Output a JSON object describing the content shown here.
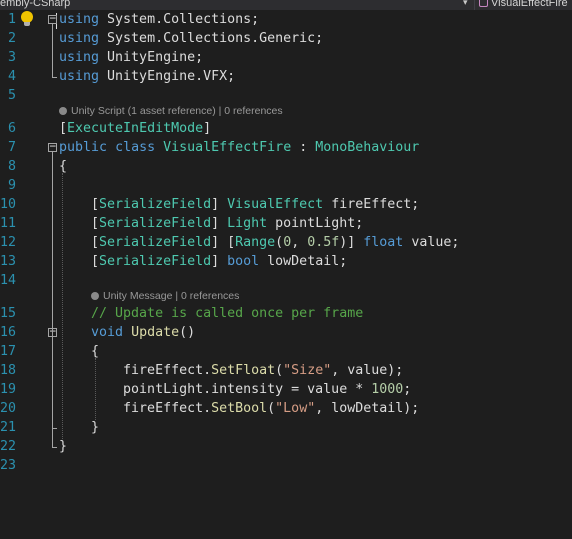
{
  "navbar": {
    "project": "embly-CSharp",
    "dropdown_glyph": "▾",
    "member": "VisualEffectFire",
    "member_icon": "class-icon"
  },
  "editor": {
    "lines": [
      {
        "n": "1",
        "tokens": [
          {
            "t": "using",
            "c": "kw"
          },
          {
            "t": " System.Collections;",
            "c": ""
          }
        ]
      },
      {
        "n": "2",
        "tokens": [
          {
            "t": "using",
            "c": "kw"
          },
          {
            "t": " System.Collections.Generic;",
            "c": ""
          }
        ]
      },
      {
        "n": "3",
        "tokens": [
          {
            "t": "using",
            "c": "kw"
          },
          {
            "t": " UnityEngine;",
            "c": ""
          }
        ]
      },
      {
        "n": "4",
        "tokens": [
          {
            "t": "using",
            "c": "kw"
          },
          {
            "t": " UnityEngine.VFX;",
            "c": ""
          }
        ]
      },
      {
        "n": "5",
        "tokens": []
      },
      {
        "n": "6",
        "tokens": [
          {
            "t": "[",
            "c": ""
          },
          {
            "t": "ExecuteInEditMode",
            "c": "type"
          },
          {
            "t": "]",
            "c": ""
          }
        ]
      },
      {
        "n": "7",
        "tokens": [
          {
            "t": "public",
            "c": "kw"
          },
          {
            "t": " ",
            "c": ""
          },
          {
            "t": "class",
            "c": "kw"
          },
          {
            "t": " ",
            "c": ""
          },
          {
            "t": "VisualEffectFire",
            "c": "type"
          },
          {
            "t": " : ",
            "c": ""
          },
          {
            "t": "MonoBehaviour",
            "c": "type"
          }
        ]
      },
      {
        "n": "8",
        "tokens": [
          {
            "t": "{",
            "c": ""
          }
        ]
      },
      {
        "n": "9",
        "tokens": []
      },
      {
        "n": "10",
        "tokens": [
          {
            "t": "    [",
            "c": ""
          },
          {
            "t": "SerializeField",
            "c": "type"
          },
          {
            "t": "] ",
            "c": ""
          },
          {
            "t": "VisualEffect",
            "c": "type"
          },
          {
            "t": " fireEffect;",
            "c": ""
          }
        ]
      },
      {
        "n": "11",
        "tokens": [
          {
            "t": "    [",
            "c": ""
          },
          {
            "t": "SerializeField",
            "c": "type"
          },
          {
            "t": "] ",
            "c": ""
          },
          {
            "t": "Light",
            "c": "type"
          },
          {
            "t": " pointLight;",
            "c": ""
          }
        ]
      },
      {
        "n": "12",
        "tokens": [
          {
            "t": "    [",
            "c": ""
          },
          {
            "t": "SerializeField",
            "c": "type"
          },
          {
            "t": "] [",
            "c": ""
          },
          {
            "t": "Range",
            "c": "type"
          },
          {
            "t": "(",
            "c": ""
          },
          {
            "t": "0",
            "c": "num"
          },
          {
            "t": ", ",
            "c": ""
          },
          {
            "t": "0.5f",
            "c": "num"
          },
          {
            "t": ")] ",
            "c": ""
          },
          {
            "t": "float",
            "c": "kw"
          },
          {
            "t": " value;",
            "c": ""
          }
        ]
      },
      {
        "n": "13",
        "tokens": [
          {
            "t": "    [",
            "c": ""
          },
          {
            "t": "SerializeField",
            "c": "type"
          },
          {
            "t": "] ",
            "c": ""
          },
          {
            "t": "bool",
            "c": "kw"
          },
          {
            "t": " lowDetail;",
            "c": ""
          }
        ]
      },
      {
        "n": "14",
        "tokens": []
      },
      {
        "n": "15",
        "tokens": [
          {
            "t": "    // Update is called once per frame",
            "c": "comment"
          }
        ]
      },
      {
        "n": "16",
        "tokens": [
          {
            "t": "    ",
            "c": ""
          },
          {
            "t": "void",
            "c": "kw"
          },
          {
            "t": " ",
            "c": ""
          },
          {
            "t": "Update",
            "c": "method"
          },
          {
            "t": "()",
            "c": ""
          }
        ]
      },
      {
        "n": "17",
        "tokens": [
          {
            "t": "    {",
            "c": ""
          }
        ]
      },
      {
        "n": "18",
        "tokens": [
          {
            "t": "        fireEffect.",
            "c": ""
          },
          {
            "t": "SetFloat",
            "c": "method"
          },
          {
            "t": "(",
            "c": ""
          },
          {
            "t": "\"Size\"",
            "c": "str"
          },
          {
            "t": ", value);",
            "c": ""
          }
        ]
      },
      {
        "n": "19",
        "tokens": [
          {
            "t": "        pointLight.intensity = value * ",
            "c": ""
          },
          {
            "t": "1000",
            "c": "num"
          },
          {
            "t": ";",
            "c": ""
          }
        ]
      },
      {
        "n": "20",
        "tokens": [
          {
            "t": "        fireEffect.",
            "c": ""
          },
          {
            "t": "SetBool",
            "c": "method"
          },
          {
            "t": "(",
            "c": ""
          },
          {
            "t": "\"Low\"",
            "c": "str"
          },
          {
            "t": ", lowDetail);",
            "c": ""
          }
        ]
      },
      {
        "n": "21",
        "tokens": [
          {
            "t": "    }",
            "c": ""
          }
        ]
      },
      {
        "n": "22",
        "tokens": [
          {
            "t": "}",
            "c": ""
          }
        ]
      },
      {
        "n": "23",
        "tokens": []
      }
    ],
    "codelens": {
      "class": {
        "kind": "Unity Script (1 asset reference)",
        "sep": " | ",
        "refs": "0 references"
      },
      "method": {
        "kind": "Unity Message",
        "sep": " | ",
        "refs": "0 references"
      }
    },
    "colors": {
      "background": "#1e1e1e",
      "text": "#dcdcdc",
      "keyword": "#569cd6",
      "type": "#4ec9b0",
      "number": "#b5cea8",
      "string": "#d69d85",
      "comment": "#57a64a",
      "method": "#dcdcaa",
      "line_number": "#2b91af"
    }
  }
}
